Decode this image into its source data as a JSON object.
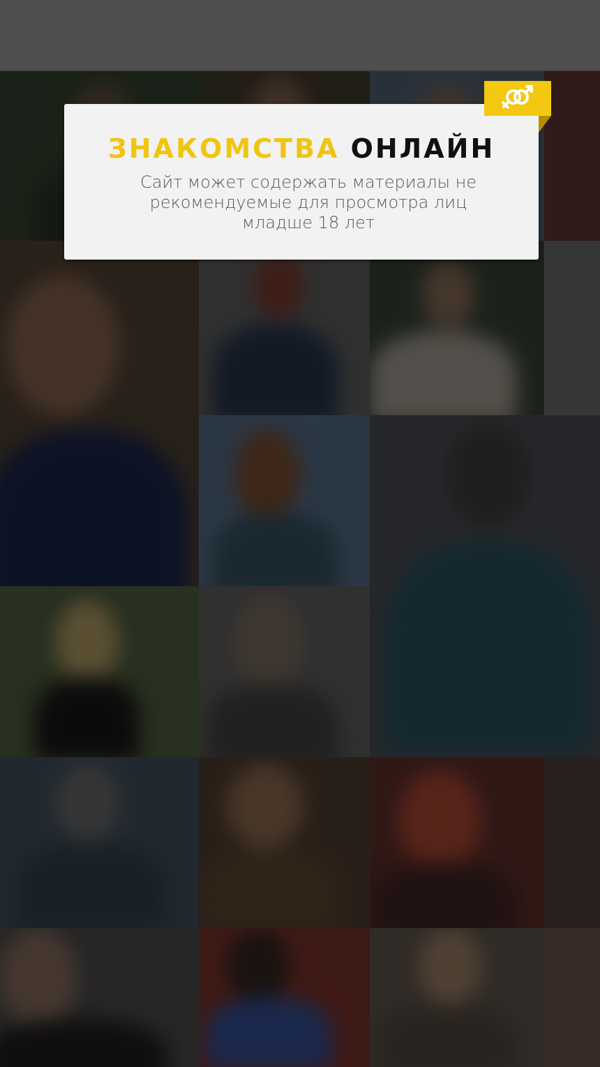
{
  "header": {
    "title_part1": "ЗНАКОМСТВА",
    "title_part2": "ОНЛАЙН",
    "disclaimer": "Сайт может содержать материалы не рекомендуемые для просмотра лиц младше 18 лет"
  },
  "badge": {
    "icon": "gender-symbols-icon"
  },
  "colors": {
    "accent": "#f1c40f",
    "card_bg": "#f2f2f2",
    "topbar": "#4f4f4f"
  }
}
